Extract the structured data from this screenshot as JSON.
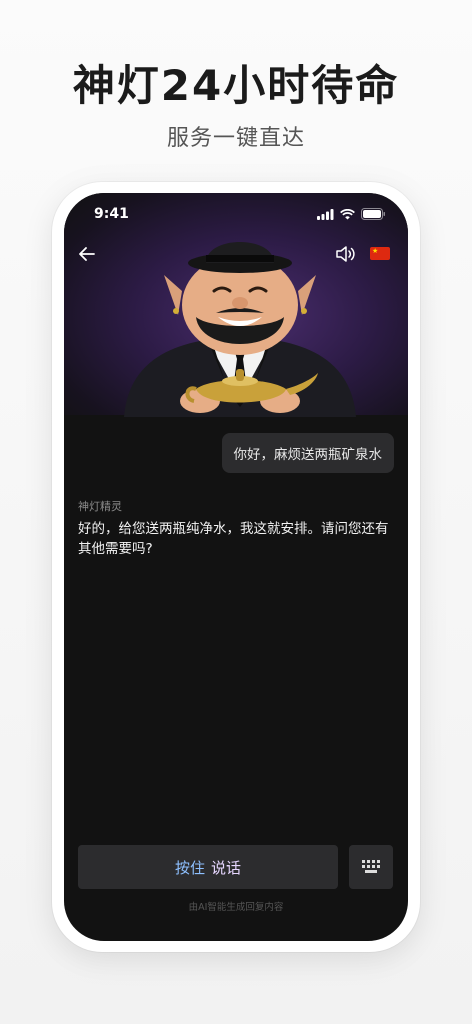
{
  "header": {
    "title": "神灯24小时待命",
    "subtitle": "服务一键直达"
  },
  "status_bar": {
    "time": "9:41"
  },
  "top_bar": {
    "back_icon": "arrow-left-icon",
    "speaker_icon": "speaker-icon",
    "language_flag": "china-flag-icon"
  },
  "chat": {
    "user_message": "你好，麻烦送两瓶矿泉水",
    "bot_name": "神灯精灵",
    "bot_message": "好的，给您送两瓶纯净水，我这就安排。请问您还有其他需要吗?"
  },
  "input": {
    "talk_label_a": "按住",
    "talk_label_b": "说话",
    "keyboard_icon": "keyboard-icon"
  },
  "footer": {
    "disclaimer": "由AI智能生成回复内容"
  },
  "colors": {
    "background": "#121212",
    "bubble": "#2c2c2e",
    "accent_blue": "#8ec0ff",
    "accent_purple": "#4a2d6e"
  }
}
